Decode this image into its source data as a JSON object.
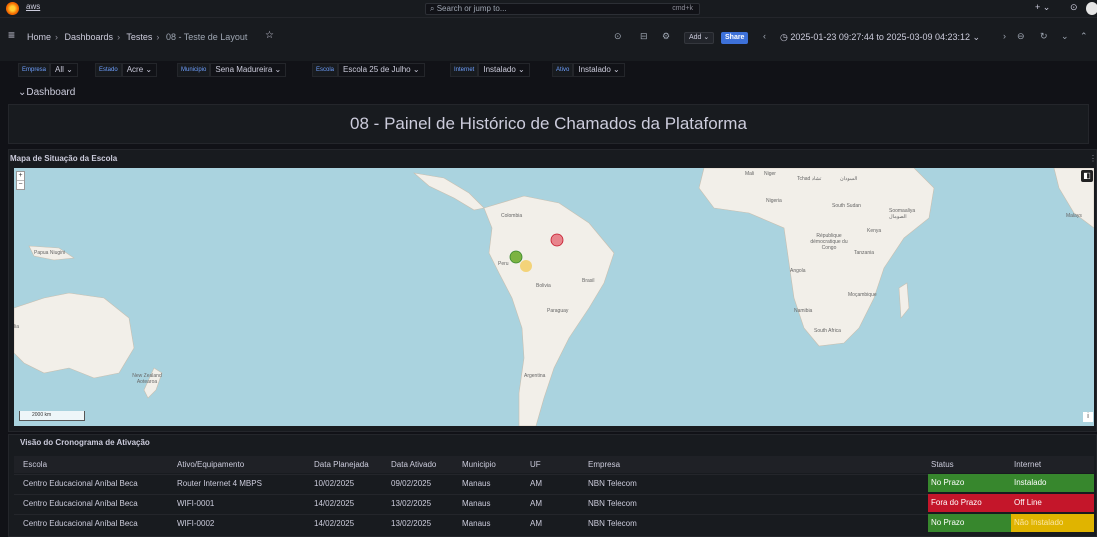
{
  "topbar": {
    "brand_label": "aws",
    "search_placeholder": "Search or jump to...",
    "search_shortcut": "cmd+k",
    "plus_label": "+",
    "help_icon": "help-icon"
  },
  "breadcrumb": {
    "home": "Home",
    "dashboards": "Dashboards",
    "folder": "Testes",
    "current": "08 - Teste de Layout"
  },
  "toolbar": {
    "add_label": "Add",
    "share_label": "Share",
    "time_range": "2025-01-23 09:27:44 to 2025-03-09 04:23:12"
  },
  "variables": [
    {
      "label": "Empresa",
      "value": "All"
    },
    {
      "label": "Estado",
      "value": "Acre"
    },
    {
      "label": "Municipio",
      "value": "Sena Madureira"
    },
    {
      "label": "Escola",
      "value": "Escola 25 de Julho"
    },
    {
      "label": "Internet",
      "value": "Instalado"
    },
    {
      "label": "Ativo",
      "value": "Instalado"
    }
  ],
  "row_title": "Dashboard",
  "title_panel": {
    "text": "08 - Painel de Histórico de Chamados da Plataforma"
  },
  "map_panel": {
    "title": "Mapa de Situação da Escola",
    "scale_label": "2000 km",
    "labels": {
      "colombia": "Colombia",
      "peru": "Peru",
      "brasil": "Brasil",
      "bolivia": "Bolivia",
      "paraguay": "Paraguay",
      "argentina": "Argentina",
      "papua": "Papua Niugini",
      "nz": "New Zealand Aotearoa",
      "mali": "Mali",
      "niger": "Niger",
      "tchad": "Tchad تشاد",
      "sudan": "السودان",
      "nigeria": "Nigeria",
      "south_sudan": "South Sudan",
      "somalia": "Soomaaliya الصومال",
      "kenya": "Kenya",
      "rdc": "République démocratique du Congo",
      "tanzania": "Tanzania",
      "angola": "Angola",
      "mocambique": "Moçambique",
      "namibia": "Namibia",
      "south_africa": "South Africa",
      "lia": "lia",
      "malaysia": "Malays"
    },
    "markers": [
      {
        "status": "Fora do Prazo",
        "color": "#e8848c"
      },
      {
        "status": "No Prazo",
        "color": "#7cb342"
      },
      {
        "status": "Não Instalado",
        "color": "#f2cc5c"
      }
    ]
  },
  "table_panel": {
    "title": "Visão do Cronograma de Ativação",
    "columns": [
      "Escola",
      "Ativo/Equipamento",
      "Data Planejada",
      "Data Ativado",
      "Municipio",
      "UF",
      "Empresa",
      "Status",
      "Internet"
    ],
    "rows": [
      [
        "Centro Educacional Aníbal Beca",
        "Router Internet 4 MBPS",
        "10/02/2025",
        "09/02/2025",
        "Manaus",
        "AM",
        "NBN Telecom",
        "No Prazo",
        "Instalado"
      ],
      [
        "Centro Educacional Aníbal Beca",
        "WIFI-0001",
        "14/02/2025",
        "13/02/2025",
        "Manaus",
        "AM",
        "NBN Telecom",
        "Fora do Prazo",
        "Off Line"
      ],
      [
        "Centro Educacional Aníbal Beca",
        "WIFI-0002",
        "14/02/2025",
        "13/02/2025",
        "Manaus",
        "AM",
        "NBN Telecom",
        "No Prazo",
        "Não Instalado"
      ]
    ],
    "status_colors": {
      "green": "#37872d",
      "red": "#c4162a",
      "yellow": "#e0b400"
    }
  }
}
